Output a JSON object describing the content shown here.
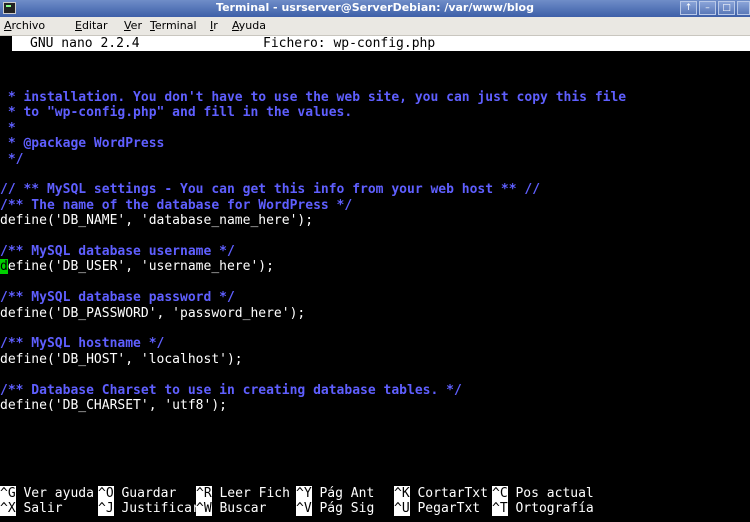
{
  "window": {
    "title": "Terminal - usrserver@ServerDebian: /var/www/blog",
    "buttons": [
      "↑",
      "–",
      "□"
    ]
  },
  "menubar": {
    "items": [
      "Archivo",
      "Editar",
      "Ver",
      "Terminal",
      "Ir",
      "Ayuda"
    ]
  },
  "nano": {
    "version": "GNU nano 2.2.4",
    "file": "Fichero: wp-config.php"
  },
  "editor": {
    "lines": [
      {
        "type": "comment",
        "text": " * installation. You don't have to use the web site, you can just copy this file"
      },
      {
        "type": "comment",
        "text": " * to \"wp-config.php\" and fill in the values."
      },
      {
        "type": "comment",
        "text": " *"
      },
      {
        "type": "comment",
        "text": " * @package WordPress"
      },
      {
        "type": "comment",
        "text": " */"
      },
      {
        "type": "blank",
        "text": ""
      },
      {
        "type": "comment",
        "text": "// ** MySQL settings - You can get this info from your web host ** //"
      },
      {
        "type": "comment",
        "text": "/** The name of the database for WordPress */"
      },
      {
        "type": "code",
        "text": "define('DB_NAME', 'database_name_here');"
      },
      {
        "type": "blank",
        "text": ""
      },
      {
        "type": "comment",
        "text": "/** MySQL database username */"
      },
      {
        "type": "code_cursor",
        "cursor_char": "d",
        "text": "efine('DB_USER', 'username_here');"
      },
      {
        "type": "blank",
        "text": ""
      },
      {
        "type": "comment",
        "text": "/** MySQL database password */"
      },
      {
        "type": "code",
        "text": "define('DB_PASSWORD', 'password_here');"
      },
      {
        "type": "blank",
        "text": ""
      },
      {
        "type": "comment",
        "text": "/** MySQL hostname */"
      },
      {
        "type": "code",
        "text": "define('DB_HOST', 'localhost');"
      },
      {
        "type": "blank",
        "text": ""
      },
      {
        "type": "comment",
        "text": "/** Database Charset to use in creating database tables. */"
      },
      {
        "type": "code",
        "text": "define('DB_CHARSET', 'utf8');"
      }
    ]
  },
  "shortcuts": {
    "row1": [
      {
        "key": "^G",
        "label": "Ver ayuda"
      },
      {
        "key": "^O",
        "label": "Guardar"
      },
      {
        "key": "^R",
        "label": "Leer Fich"
      },
      {
        "key": "^Y",
        "label": "Pág Ant"
      },
      {
        "key": "^K",
        "label": "CortarTxt"
      },
      {
        "key": "^C",
        "label": "Pos actual"
      }
    ],
    "row2": [
      {
        "key": "^X",
        "label": "Salir"
      },
      {
        "key": "^J",
        "label": "Justificar"
      },
      {
        "key": "^W",
        "label": "Buscar"
      },
      {
        "key": "^V",
        "label": "Pág Sig"
      },
      {
        "key": "^U",
        "label": "PegarTxt"
      },
      {
        "key": "^T",
        "label": "Ortografía"
      }
    ]
  },
  "colors": {
    "comment": "#5f5fff",
    "cursor": "#00d000",
    "titlebar": "#4f6fb8"
  }
}
